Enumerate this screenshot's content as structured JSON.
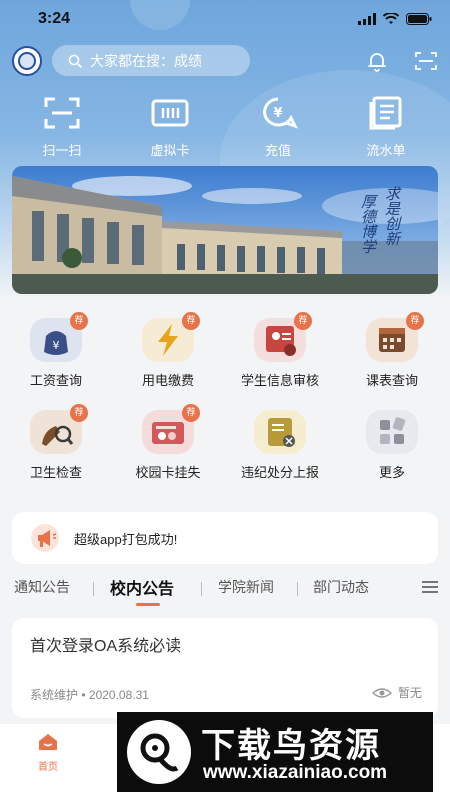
{
  "status_bar": {
    "time": "3:24"
  },
  "header": {
    "search_placeholder": "大家都在搜：成绩"
  },
  "quick_actions": [
    {
      "label": "扫一扫",
      "icon": "scan-icon"
    },
    {
      "label": "虚拟卡",
      "icon": "card-icon"
    },
    {
      "label": "充值",
      "icon": "recharge-icon"
    },
    {
      "label": "流水单",
      "icon": "ledger-icon"
    }
  ],
  "banner": {
    "slogan_col1": "厚德博学",
    "slogan_col2": "求是创新"
  },
  "services": [
    {
      "label": "工资查询",
      "icon": "salary-icon",
      "badge": "荐"
    },
    {
      "label": "用电缴费",
      "icon": "electricity-icon",
      "badge": "荐"
    },
    {
      "label": "学生信息审核",
      "icon": "student-info-icon",
      "badge": "荐"
    },
    {
      "label": "课表查询",
      "icon": "schedule-icon",
      "badge": "荐"
    },
    {
      "label": "卫生检查",
      "icon": "hygiene-icon",
      "badge": "荐"
    },
    {
      "label": "校园卡挂失",
      "icon": "card-loss-icon",
      "badge": "荐"
    },
    {
      "label": "违纪处分上报",
      "icon": "discipline-icon",
      "badge": ""
    },
    {
      "label": "更多",
      "icon": "more-icon",
      "badge": ""
    }
  ],
  "notice": {
    "text": "超级app打包成功!"
  },
  "tabs": [
    {
      "label": "通知公告",
      "active": false
    },
    {
      "label": "校内公告",
      "active": true
    },
    {
      "label": "学院新闻",
      "active": false
    },
    {
      "label": "部门动态",
      "active": false
    }
  ],
  "article": {
    "title": "首次登录OA系统必读",
    "author": "系统维护",
    "date": "2020.08.31",
    "views": "暂无"
  },
  "bottom_nav": {
    "home_label": "首页"
  },
  "watermark": {
    "title": "下载鸟资源",
    "url": "www.xiazainiao.com"
  },
  "colors": {
    "accent": "#e8734a",
    "header_blue": "#6ea6dc"
  }
}
